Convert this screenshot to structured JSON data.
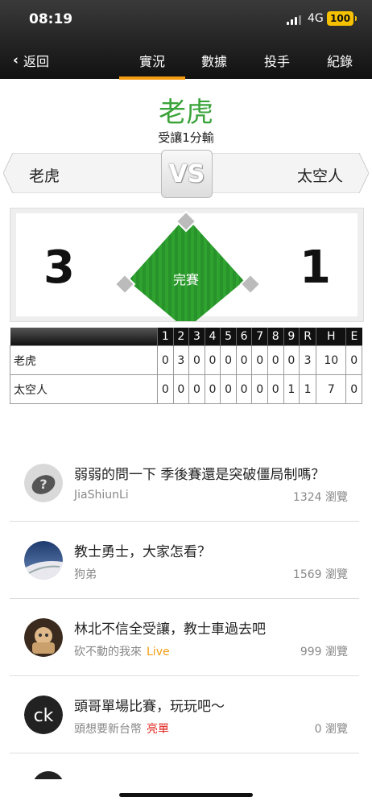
{
  "status": {
    "time": "08:19",
    "network": "4G",
    "battery": "100"
  },
  "nav": {
    "back_label": "返回",
    "tabs": [
      {
        "label": "實況",
        "active": true
      },
      {
        "label": "數據",
        "active": false
      },
      {
        "label": "投手",
        "active": false
      },
      {
        "label": "紀錄",
        "active": false
      }
    ]
  },
  "result": {
    "winner": "老虎",
    "note": "受讓1分輸"
  },
  "teams": {
    "home": "老虎",
    "away": "太空人",
    "vs": "VS"
  },
  "scoreboard": {
    "home_score": "3",
    "away_score": "1",
    "status": "完賽"
  },
  "boxscore": {
    "headers": [
      "1",
      "2",
      "3",
      "4",
      "5",
      "6",
      "7",
      "8",
      "9",
      "R",
      "H",
      "E"
    ],
    "rows": [
      {
        "team": "老虎",
        "cells": [
          "0",
          "3",
          "0",
          "0",
          "0",
          "0",
          "0",
          "0",
          "0",
          "3",
          "10",
          "0"
        ]
      },
      {
        "team": "太空人",
        "cells": [
          "0",
          "0",
          "0",
          "0",
          "0",
          "0",
          "0",
          "0",
          "1",
          "1",
          "7",
          "0"
        ]
      }
    ]
  },
  "posts": [
    {
      "title": "弱弱的問一下 季後賽還是突破僵局制嗎？",
      "author": "JiaShiunLi",
      "tag": "",
      "views": "1324 瀏覽",
      "avatar": "question-avatar"
    },
    {
      "title": "教士勇士，大家怎看？",
      "author": "狗弟",
      "tag": "",
      "views": "1569 瀏覽",
      "avatar": "landscape-avatar"
    },
    {
      "title": "林北不信全受讓，教士車過去吧",
      "author": "砍不動的我來",
      "tag": "Live",
      "views": "999 瀏覽",
      "avatar": "photo-avatar"
    },
    {
      "title": "頭哥單場比賽，玩玩吧～",
      "author": "頭想要新台幣",
      "tag": "亮單",
      "views": "0 瀏覽",
      "avatar": "ck-logo-avatar"
    }
  ],
  "colors": {
    "accent": "#f39c12",
    "winner": "#3aa33a",
    "live": "#f39c12",
    "tag_red": "#e0231c"
  }
}
